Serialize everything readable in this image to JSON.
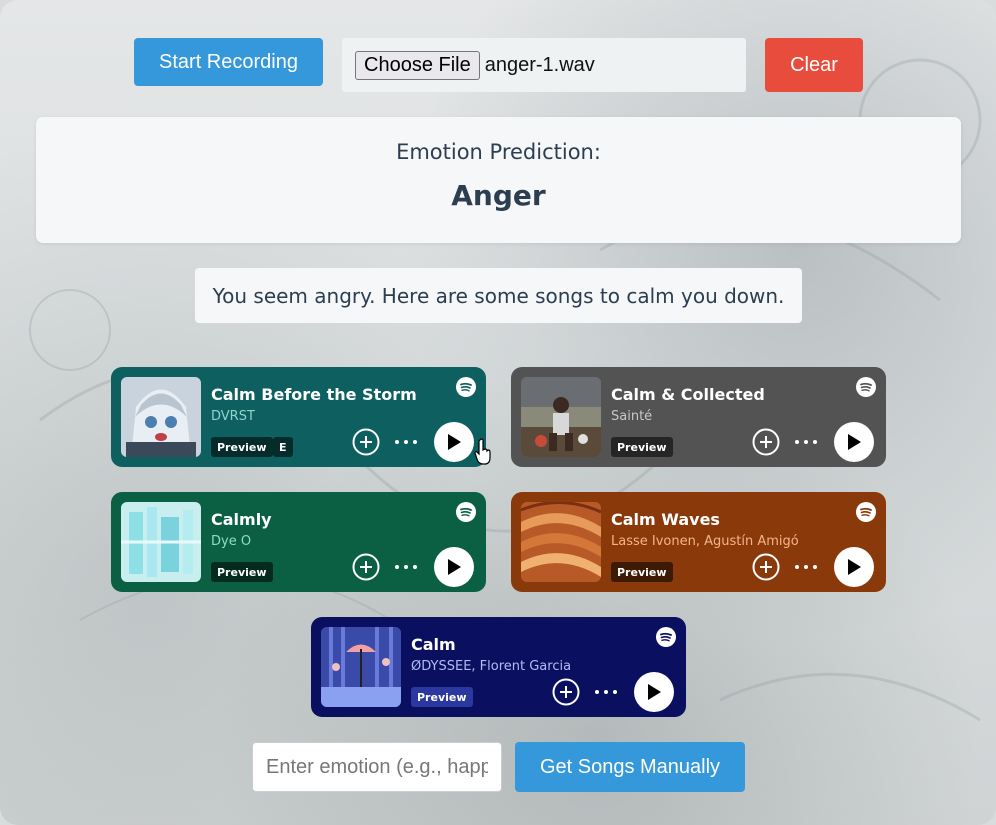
{
  "controls": {
    "record_label": "Start Recording",
    "choose_file_label": "Choose File",
    "file_name": "anger-1.wav",
    "clear_label": "Clear"
  },
  "prediction": {
    "label": "Emotion Prediction:",
    "value": "Anger"
  },
  "message": "You seem angry. Here are some songs to calm you down.",
  "songs": [
    {
      "title": "Calm Before the Storm",
      "artist": "DVRST",
      "badge": "Preview",
      "explicit_badge": "E",
      "color": "#0d5f60",
      "artist_color": "#8fd4d0"
    },
    {
      "title": "Calm & Collected",
      "artist": "Sainté",
      "badge": "Preview",
      "color": "#535353",
      "artist_color": "#c8c8c8"
    },
    {
      "title": "Calmly",
      "artist": "Dye O",
      "badge": "Preview",
      "color": "#0b6044",
      "artist_color": "#8fdcc0"
    },
    {
      "title": "Calm Waves",
      "artist": "Lasse Ivonen, Agustín Amigó",
      "badge": "Preview",
      "color": "#8a3a0a",
      "artist_color": "#f4b48a"
    },
    {
      "title": "Calm",
      "artist": "ØDYSSEE, Florent Garcia",
      "badge": "Preview",
      "color": "#0a0f60",
      "artist_color": "#b4bcf4"
    }
  ],
  "manual": {
    "placeholder": "Enter emotion (e.g., happy, sad)",
    "button_label": "Get Songs Manually"
  },
  "icons": {
    "spotify": "spotify-icon",
    "add": "add-circle-icon",
    "more": "more-dots-icon",
    "play": "play-icon"
  }
}
